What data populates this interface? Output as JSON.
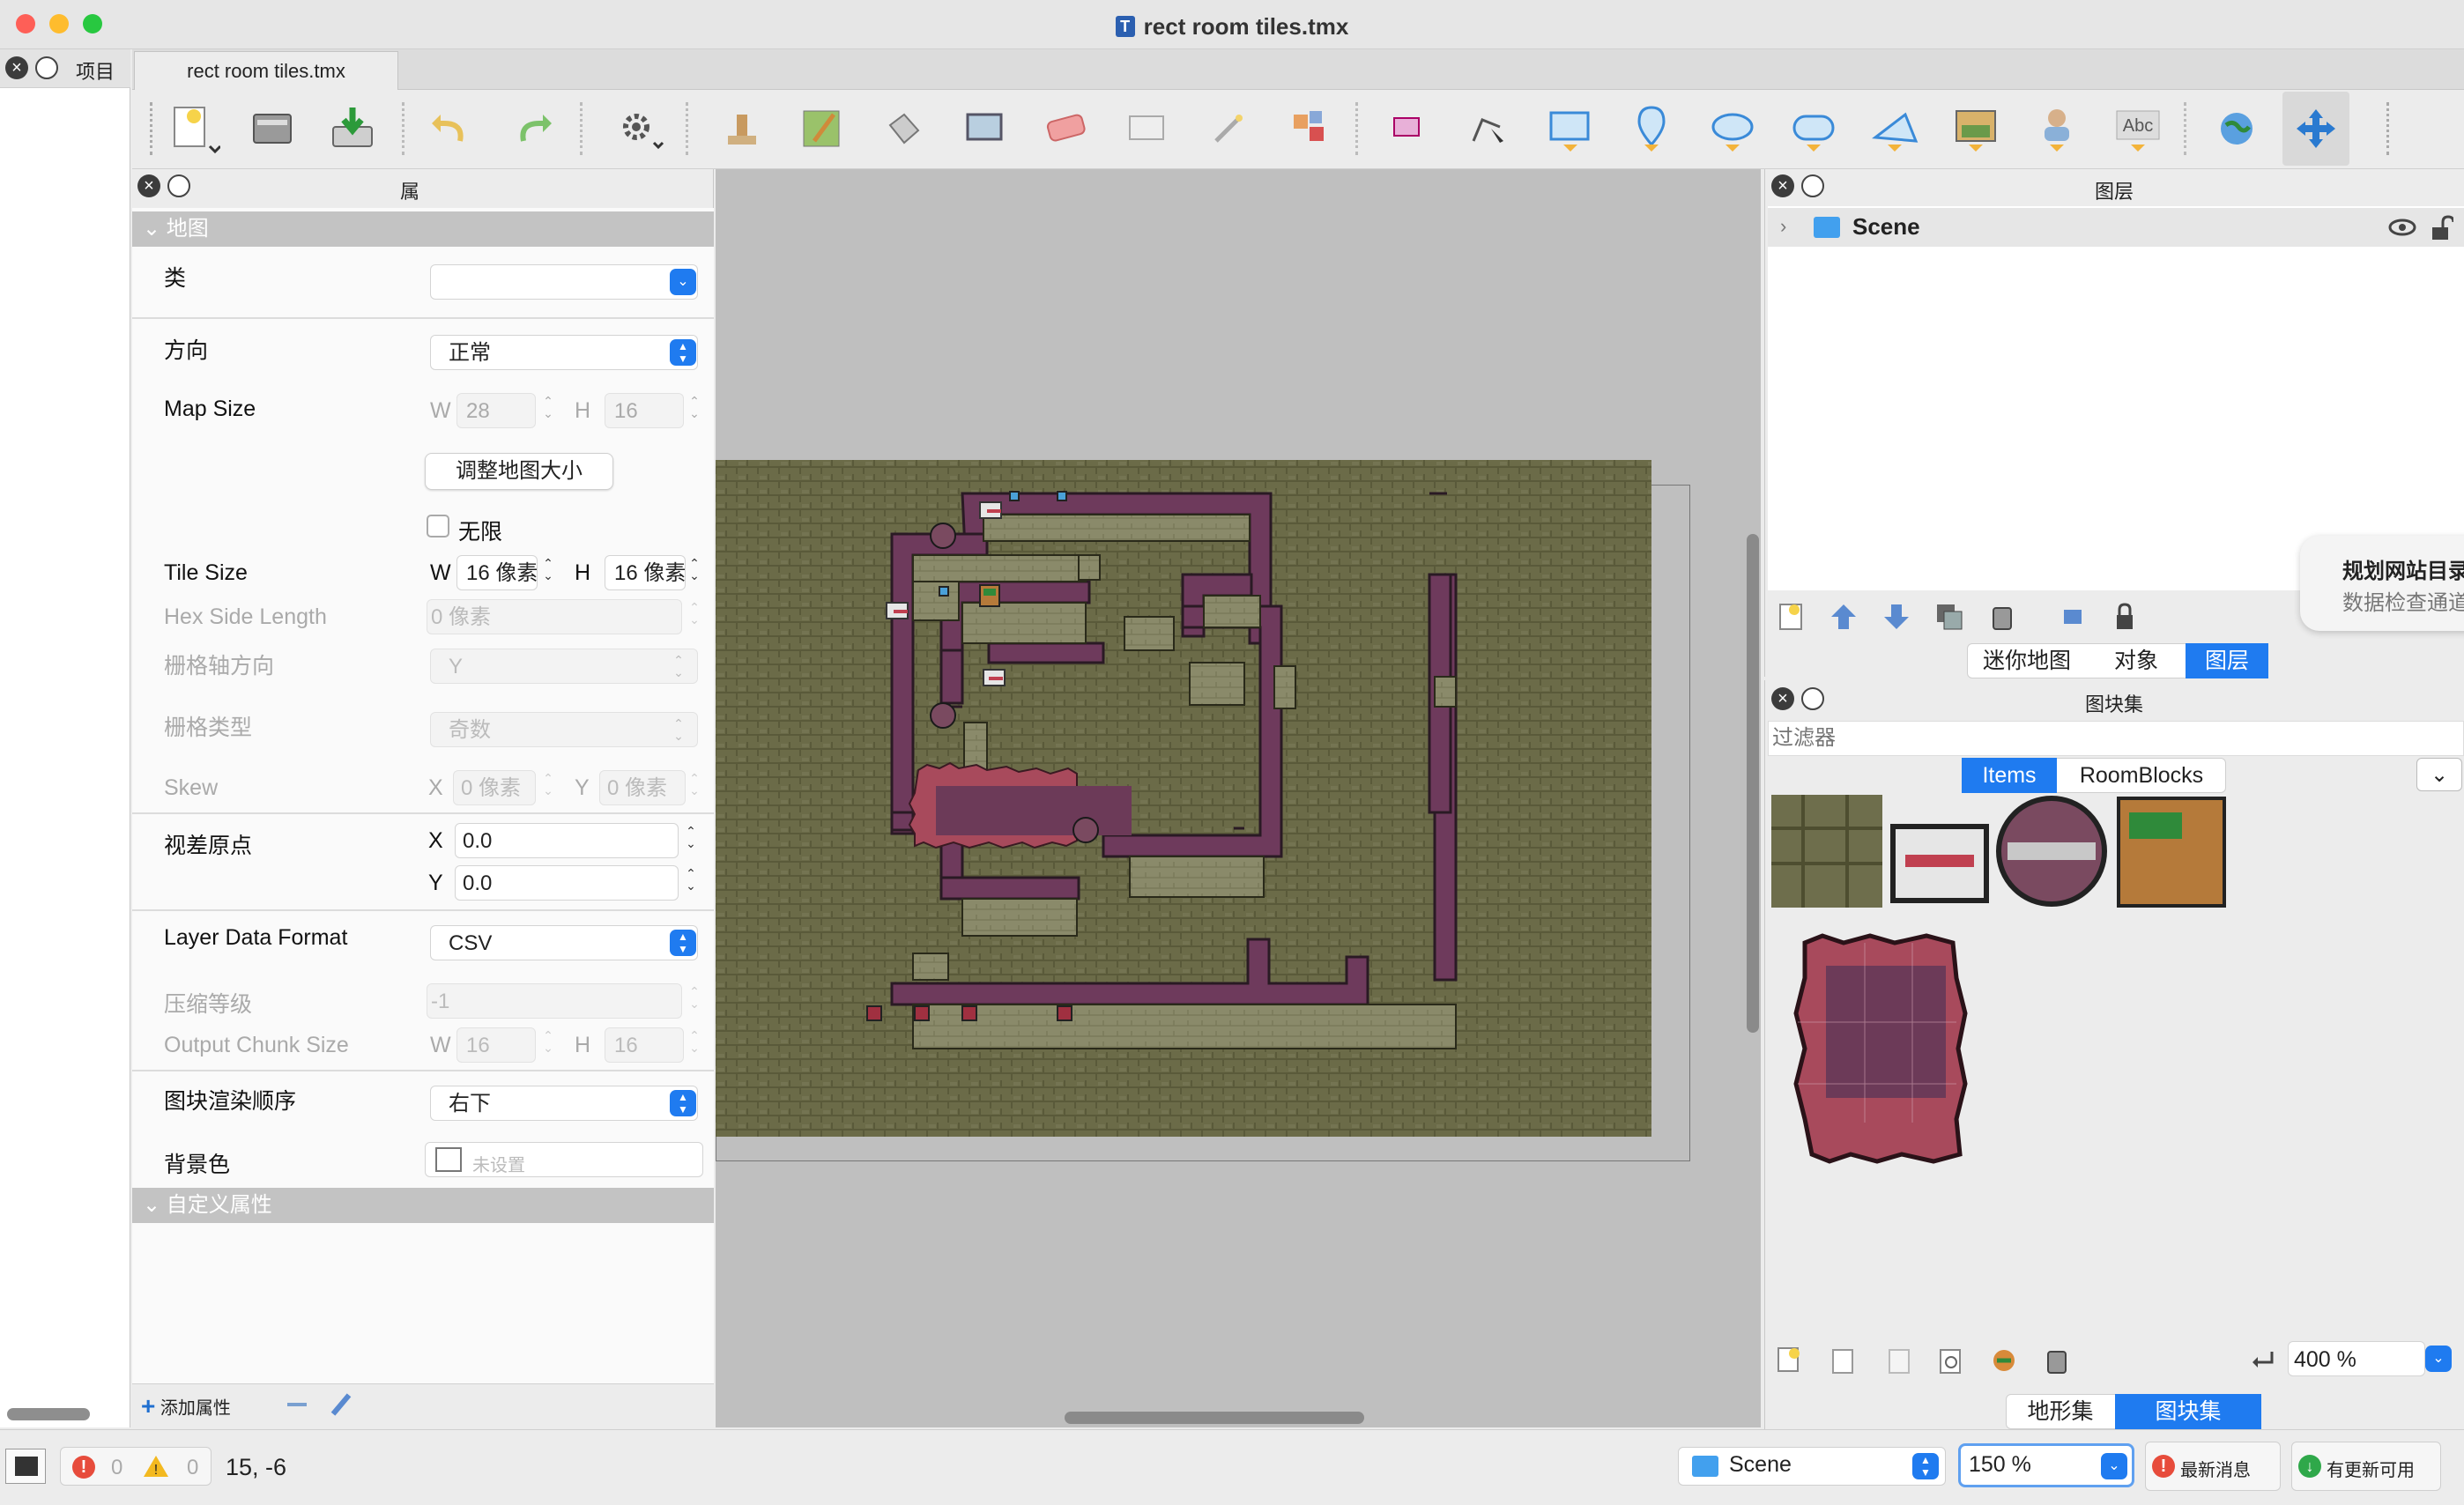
{
  "window": {
    "title": "rect room tiles.tmx"
  },
  "project": {
    "label": "项目"
  },
  "doc_tab": {
    "label": "rect room tiles.tmx"
  },
  "properties": {
    "header": "属性",
    "section_map": "地图",
    "class_label": "类",
    "orientation_label": "方向",
    "orientation_value": "正常",
    "mapsize_label": "Map Size",
    "w": "W",
    "h": "H",
    "mapsize_w": "28",
    "mapsize_h": "16",
    "resize_button": "调整地图大小",
    "infinite_label": "无限",
    "tilesize_label": "Tile Size",
    "tilesize_w": "16 像素",
    "tilesize_h": "16 像素",
    "hexside_label": "Hex Side Length",
    "hexside_value": "0 像素",
    "stagger_axis_label": "栅格轴方向",
    "stagger_axis_value": "Y",
    "stagger_index_label": "栅格类型",
    "stagger_index_value": "奇数",
    "skew_label": "Skew",
    "x": "X",
    "y": "Y",
    "skew_x": "0 像素",
    "skew_y": "0 像素",
    "parallax_label": "视差原点",
    "parallax_x": "0.0",
    "parallax_y": "0.0",
    "layer_format_label": "Layer Data Format",
    "layer_format_value": "CSV",
    "compression_label": "压缩等级",
    "compression_value": "-1",
    "chunk_label": "Output Chunk Size",
    "chunk_w": "16",
    "chunk_h": "16",
    "render_order_label": "图块渲染顺序",
    "render_order_value": "右下",
    "bgcolor_label": "背景色",
    "bgcolor_value": "未设置",
    "section_custom": "自定义属性",
    "add_property": "添加属性"
  },
  "layers": {
    "header": "图层",
    "items": [
      {
        "name": "Scene"
      }
    ],
    "tabs": [
      "迷你地图",
      "对象",
      "图层"
    ],
    "selected_tab": "图层"
  },
  "notification": {
    "title": "规划网站目录",
    "subtitle": "数据检查通道"
  },
  "tilesets": {
    "header": "图块集",
    "filter_placeholder": "过滤器",
    "tabs": [
      "Items",
      "RoomBlocks"
    ],
    "selected_tab": "Items",
    "zoom": "400 %",
    "bottom_tabs": [
      "地形集",
      "图块集"
    ],
    "selected_bottom_tab": "图块集"
  },
  "status": {
    "errors": "0",
    "warnings": "0",
    "coords": "15, -6",
    "layer": "Scene",
    "zoom": "150 %",
    "news": "最新消息",
    "update": "有更新可用"
  },
  "colors": {
    "accent": "#1f7bf0",
    "map_ground": "#6a6a48",
    "wall": "#6e3a5c",
    "floor": "#8c8b6b",
    "carpet": "#a84a5c",
    "carpet_inner": "#6c3a58"
  }
}
